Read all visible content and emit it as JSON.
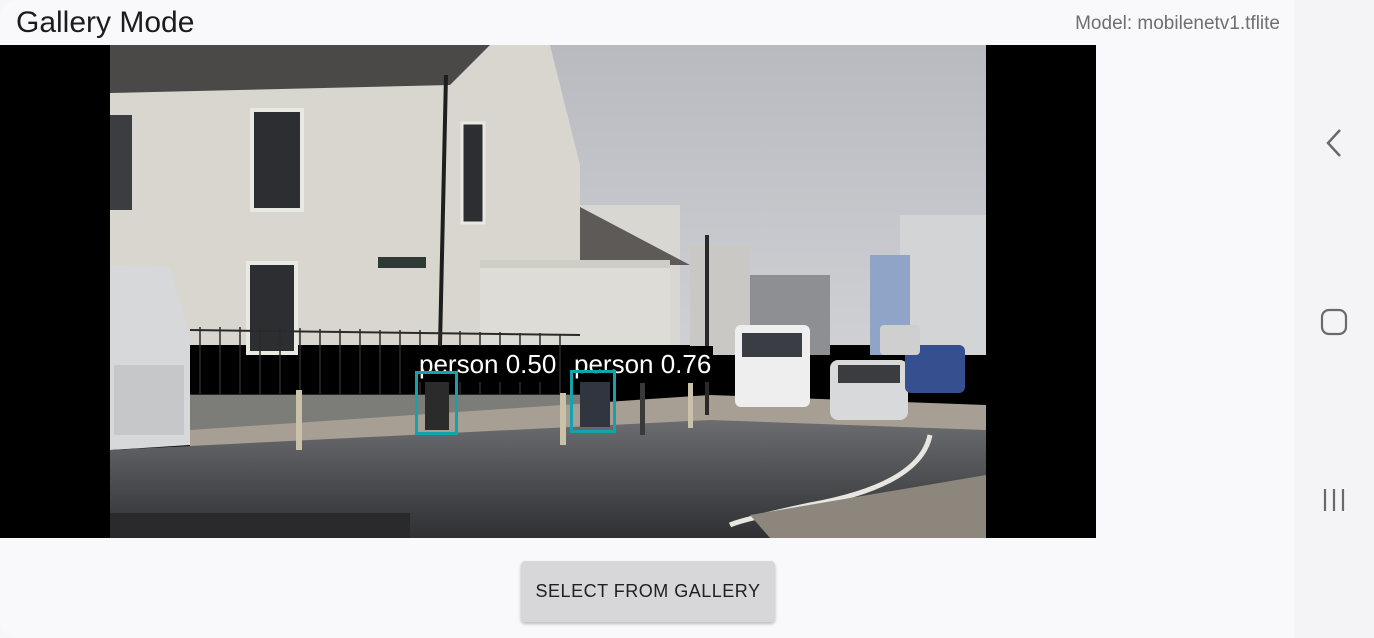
{
  "app": {
    "title": "Gallery Mode",
    "model_label": "Model: mobilenetv1.tflite"
  },
  "detections": [
    {
      "label": "person 0.50"
    },
    {
      "label": "person 0.76"
    }
  ],
  "actions": {
    "select_gallery_label": "SELECT FROM GALLERY"
  },
  "navigation": {
    "back_icon": "chevron-left-icon",
    "home_icon": "square-home-icon",
    "recents_icon": "three-bars-recents-icon"
  },
  "colors": {
    "detection_box": "#13a3ad",
    "label_bg": "#000000"
  }
}
